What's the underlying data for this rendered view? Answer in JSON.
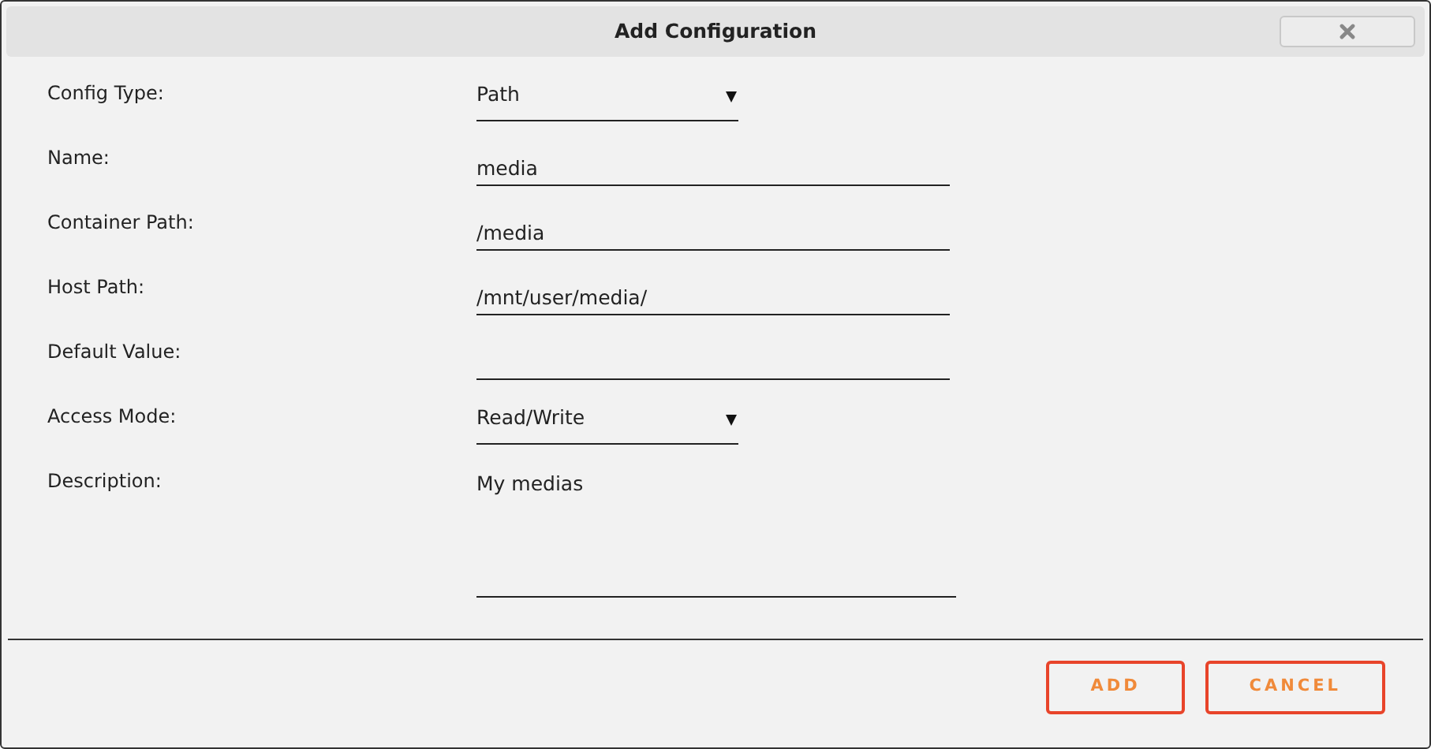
{
  "window": {
    "title": "Add Configuration"
  },
  "fields": [
    {
      "label": "Config Type:",
      "kind": "select",
      "value": "Path"
    },
    {
      "label": "Name:",
      "kind": "text",
      "value": "media"
    },
    {
      "label": "Container Path:",
      "kind": "text",
      "value": "/media"
    },
    {
      "label": "Host Path:",
      "kind": "text",
      "value": "/mnt/user/media/"
    },
    {
      "label": "Default Value:",
      "kind": "text"
    },
    {
      "label": "Access Mode:",
      "kind": "select",
      "value": "Read/Write"
    },
    {
      "label": "Description:",
      "kind": "textarea",
      "value": "My medias"
    }
  ],
  "buttons": [
    "ADD",
    "CANCEL"
  ]
}
